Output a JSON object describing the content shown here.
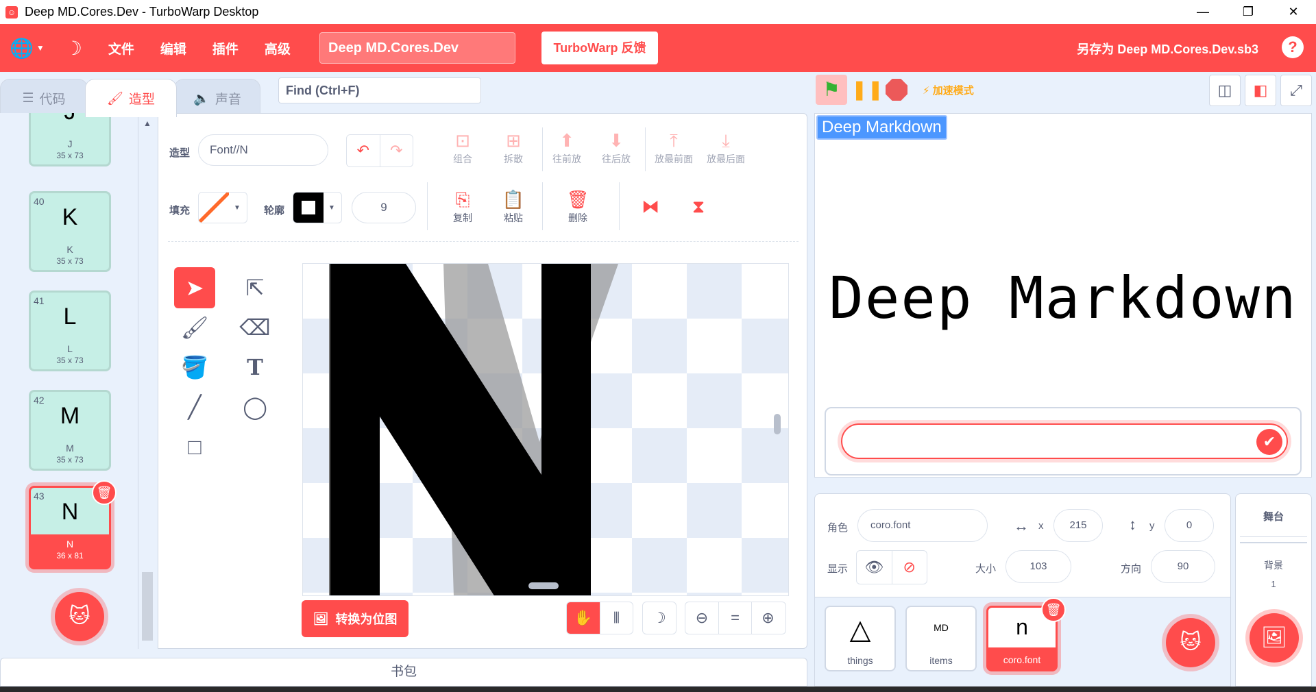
{
  "window": {
    "title": "Deep MD.Cores.Dev - TurboWarp Desktop",
    "controls": [
      "—",
      "❐",
      "✕"
    ]
  },
  "menubar": {
    "menus": [
      "文件",
      "编辑",
      "插件",
      "高级"
    ],
    "project_title": "Deep MD.Cores.Dev",
    "feedback_label": "TurboWarp 反馈",
    "save_as_label": "另存为 Deep MD.Cores.Dev.sb3",
    "help_label": "?"
  },
  "tabs": [
    {
      "label": "代码",
      "icon": "code-icon"
    },
    {
      "label": "造型",
      "icon": "brush-icon",
      "active": true
    },
    {
      "label": "声音",
      "icon": "speaker-icon"
    }
  ],
  "find": {
    "placeholder": "Find (Ctrl+F)"
  },
  "costumes": [
    {
      "num": "",
      "glyph": "J",
      "name": "J",
      "size": "35 x 73"
    },
    {
      "num": "40",
      "glyph": "K",
      "name": "K",
      "size": "35 x 73"
    },
    {
      "num": "41",
      "glyph": "L",
      "name": "L",
      "size": "35 x 73"
    },
    {
      "num": "42",
      "glyph": "M",
      "name": "M",
      "size": "35 x 73"
    },
    {
      "num": "43",
      "glyph": "N",
      "name": "N",
      "size": "36 x 81",
      "selected": true
    }
  ],
  "editor": {
    "costume_label": "造型",
    "costume_name": "Font//N",
    "fill_label": "填充",
    "outline_label": "轮廓",
    "stroke_width": "9",
    "toolbar_row1": [
      "组合",
      "拆散",
      "往前放",
      "往后放",
      "放最前面",
      "放最后面"
    ],
    "toolbar_row2": [
      "复制",
      "粘贴",
      "删除"
    ],
    "convert_label": "转换为位图",
    "accent": "#ff4c4c"
  },
  "backpack": {
    "label": "书包"
  },
  "stage": {
    "turbo_label": "加速模式",
    "monitor_label": "Deep Markdown",
    "display_text": "Deep Markdown"
  },
  "sprite_info": {
    "sprite_label": "角色",
    "sprite_name": "coro.font",
    "x_label": "x",
    "x_value": "215",
    "y_label": "y",
    "y_value": "0",
    "show_label": "显示",
    "size_label": "大小",
    "size_value": "103",
    "direction_label": "方向",
    "direction_value": "90"
  },
  "sprites": [
    {
      "name": "things",
      "icon": "△"
    },
    {
      "name": "items",
      "icon": "MD"
    },
    {
      "name": "coro.font",
      "icon": "n",
      "selected": true
    }
  ],
  "stage_panel": {
    "title": "舞台",
    "backdrops_label": "背景",
    "backdrops_count": "1"
  }
}
